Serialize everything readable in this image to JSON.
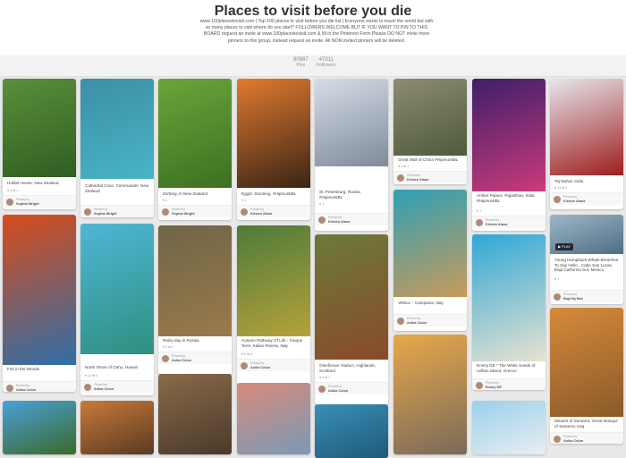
{
  "board": {
    "title": "Places to visit before you die",
    "description": "www.100placestovisit.com | Top 100 places to visit before you die list | Everyone wants to travel the world but with so many places to visit where do you start? FOLLOWERS WELCOME BUT IF YOU WANT TO PIN TO THIS BOARD request an invite at www.100placestovisit.com & fill in the Pinterest Form Please DO NOT invite more pinners to this group, instead request an invite. All NON invited pinners will be deleted.",
    "pins_count": "80987",
    "pins_label": "Pins",
    "followers_count": "47311",
    "followers_label": "Followers",
    "pinned_by_label": "Pinned by"
  },
  "pins": [
    {
      "desc": "Hobbit House, New Zealand",
      "meta": "♥ 2  ⇆ 1",
      "pinner": "Sophia Wright",
      "colors": [
        "#5a8f3a",
        "#2f5e22"
      ]
    },
    {
      "desc": "Cathedral Cove, Coromandel, New Zealand",
      "meta": "",
      "pinner": "Sophia Wright",
      "colors": [
        "#3d8fa6",
        "#48b5c4"
      ]
    },
    {
      "desc": "Zorbing, in New Zealand",
      "meta": "♥ 1",
      "pinner": "Sophia Wright",
      "colors": [
        "#6aa53a",
        "#3d7022"
      ]
    },
    {
      "desc": "Egypt. Stunning. #HipmunkBL",
      "meta": "♥ 1",
      "pinner": "Kirsten Alana",
      "colors": [
        "#e07a2f",
        "#3a2415"
      ]
    },
    {
      "desc": "St. Petersburg, Russia #HipmunkBL",
      "meta": "♥ 1",
      "pinner": "Kirsten Alana",
      "colors": [
        "#d6dde8",
        "#7f8a9a"
      ]
    },
    {
      "desc": "Great Wall of China #HipmunkBL",
      "meta": "♥ 2  ⇆ 1",
      "pinner": "Kirsten Alana",
      "colors": [
        "#8c8c72",
        "#4f5a3c"
      ]
    },
    {
      "desc": "Amber Palace, Rajasthan, India #HipmunkBL",
      "meta": "♥ 1",
      "pinner": "Kirsten Alana",
      "colors": [
        "#3f1e6a",
        "#c93b7a"
      ]
    },
    {
      "desc": "Taj Mahal, India",
      "meta": "♥ 13  ⇆ 1",
      "pinner": "Kirsten Alana",
      "colors": [
        "#e6e6ec",
        "#9e1e1e"
      ]
    },
    {
      "desc": "Fire in the Woods",
      "meta": "",
      "pinner": "Anika Colon",
      "colors": [
        "#d84b1a",
        "#2f6fa8"
      ]
    },
    {
      "desc": "North Shore of Oahu, Hawaii",
      "meta": "♥ 12  ⇆ 5",
      "pinner": "Anika Colon",
      "colors": [
        "#4fb6d6",
        "#2f8f7f"
      ]
    },
    {
      "desc": "Rainy day in Russia",
      "meta": "♥ 9  ⇆ 4",
      "pinner": "Anika Colon",
      "colors": [
        "#6f6548",
        "#9a7a4a"
      ]
    },
    {
      "desc": "Autumn Pathway Of Life - Cinque Terre, Italian Riviera, Italy",
      "meta": "♥ 6  ⇆ 4",
      "pinner": "Anika Colon",
      "colors": [
        "#4e7a3a",
        "#b5a23a"
      ]
    },
    {
      "desc": "Glenfinnan Viaduct, Highlands, Scotland",
      "meta": "♥ 2  ⇆ 1",
      "pinner": "Anika Colon",
      "colors": [
        "#6b7a3a",
        "#8a4a2a"
      ]
    },
    {
      "desc": "Vettica – Campania, Italy",
      "meta": "",
      "pinner": "Anika Colon",
      "colors": [
        "#2fa0b6",
        "#c89a5a"
      ]
    },
    {
      "desc": "Young Humpback Whale Breaches To Say Hello - Cabo San Lucas, Baja California Sur, Mexico",
      "meta": "♥ 1",
      "pinner": "Baja By Bax",
      "colors": [
        "#9fb6c8",
        "#4e6d84"
      ]
    },
    {
      "desc": "Emmy DE * The White Sands of Lefkas Island, Greece",
      "meta": "",
      "pinner": "Emmy DE",
      "colors": [
        "#2fa8d6",
        "#e8e2d0"
      ]
    },
    {
      "desc": "Minaret of Samarra, Great Mosque of Samarra, Iraq",
      "meta": "",
      "pinner": "Anika Colon",
      "colors": [
        "#d68a3a",
        "#8a5a2a"
      ]
    },
    {
      "desc": "",
      "meta": "",
      "pinner": "",
      "colors": [
        "#4aa0d8",
        "#3a6a2a"
      ]
    },
    {
      "desc": "",
      "meta": "",
      "pinner": "",
      "colors": [
        "#c87a3a",
        "#5a3a22"
      ]
    },
    {
      "desc": "",
      "meta": "",
      "pinner": "",
      "colors": [
        "#8a6a4a",
        "#4a3a2a"
      ]
    },
    {
      "desc": "",
      "meta": "",
      "pinner": "",
      "colors": [
        "#d88a7a",
        "#7a9ab6"
      ]
    },
    {
      "desc": "",
      "meta": "",
      "pinner": "",
      "colors": [
        "#3a8fb6",
        "#1e5a7a"
      ]
    },
    {
      "desc": "",
      "meta": "",
      "pinner": "",
      "colors": [
        "#e8a84a",
        "#7a6a5a"
      ]
    },
    {
      "desc": "",
      "meta": "",
      "pinner": "",
      "colors": [
        "#9ad0ea",
        "#e8eef2"
      ]
    }
  ],
  "whale_video_label": "▶ PLAY",
  "whale_pinner_source": "Baja Bax by M"
}
